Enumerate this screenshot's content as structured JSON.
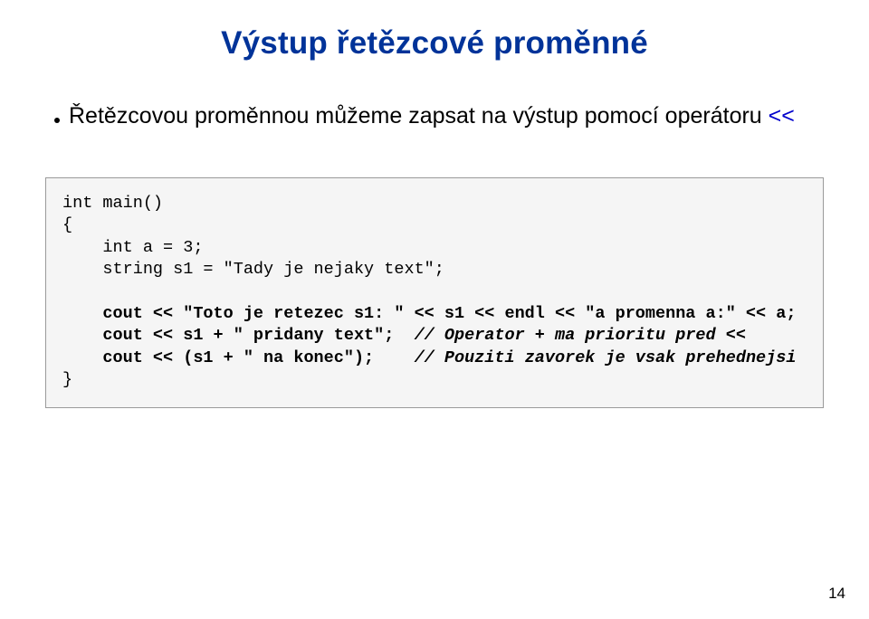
{
  "title": "Výstup řetězcové proměnné",
  "bullet": {
    "text_before": "Řetězcovou proměnnou můžeme zapsat na výstup pomocí operátoru ",
    "operator": "<<"
  },
  "code": {
    "l1": "int main()",
    "l2": "{",
    "l3": "    int a = 3;",
    "l4": "    string s1 = \"Tady je nejaky text\";",
    "blank1": "",
    "l5": "    cout << \"Toto je retezec s1: \" << s1 << endl << \"a promenna a:\" << a;",
    "l6a": "    cout << s1 + \" pridany text\";  ",
    "l6c": "// Operator + ma prioritu pred <<",
    "l7a": "    cout << (s1 + \" na konec\");    ",
    "l7c": "// Pouziti zavorek je vsak prehednejsi",
    "l8": "}"
  },
  "page_number": "14"
}
